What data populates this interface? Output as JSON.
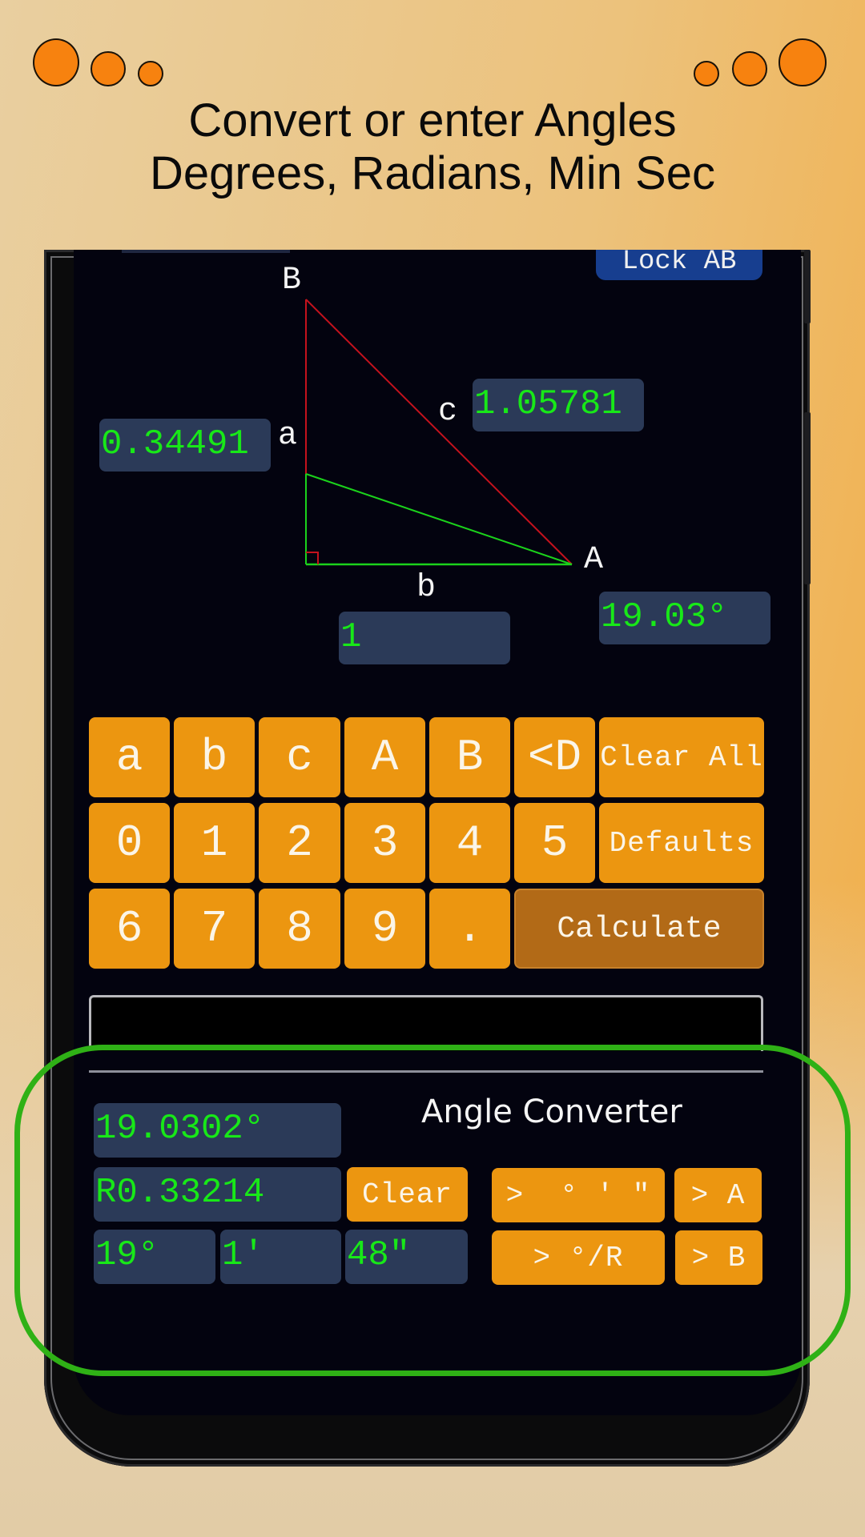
{
  "promo": {
    "headline_line1": "Convert or enter Angles",
    "headline_line2": "Degrees, Radians, Min Sec",
    "decorative_dots_color": "#f7820f",
    "highlight_color": "#2fb116"
  },
  "app": {
    "lock_button": "Lock AB",
    "triangle": {
      "vertex_labels": {
        "B": "B",
        "A": "A"
      },
      "side_labels": {
        "a": "a",
        "b": "b",
        "c": "c"
      },
      "fields": {
        "side_a": "0.34491",
        "side_b": "1",
        "side_c": "1.05781",
        "angle_A": "19.03°"
      },
      "colors": {
        "hypotenuse": "#c4121d",
        "legs": "#1bd21b",
        "value_text": "#18e818",
        "field_bg": "#2b3a58"
      }
    },
    "keypad": {
      "rows": [
        [
          "a",
          "b",
          "c",
          "A",
          "B",
          "<D"
        ],
        [
          "0",
          "1",
          "2",
          "3",
          "4",
          "5"
        ],
        [
          "6",
          "7",
          "8",
          "9",
          "."
        ]
      ],
      "clear_all": "Clear All",
      "defaults": "Defaults",
      "calculate": "Calculate",
      "key_color": "#ec9610",
      "calculate_color": "#b26a17"
    },
    "output_bar_text": "",
    "angle_converter": {
      "title": "Angle Converter",
      "degrees": "19.0302°",
      "radians": "R0.33214",
      "dms_degrees": "19°",
      "dms_minutes": "1'",
      "dms_seconds": "48\"",
      "clear": "Clear",
      "to_dms": ">  ° ' \"",
      "to_deg_rad": "> °/R",
      "to_A": "> A",
      "to_B": "> B"
    }
  }
}
